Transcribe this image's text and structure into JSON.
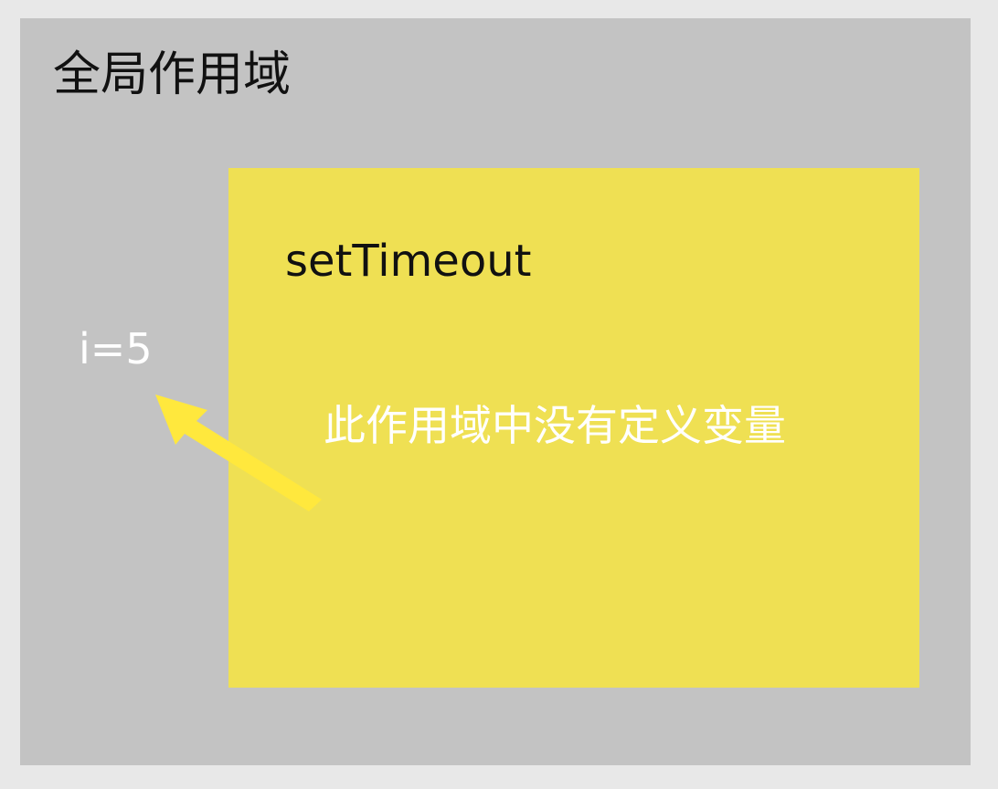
{
  "global_scope": {
    "title": "全局作用域",
    "variable": "i=5"
  },
  "inner_scope": {
    "title": "setTimeout",
    "note": "此作用域中没有定义变量"
  },
  "colors": {
    "page_background": "#e8e8e8",
    "global_scope_background": "#c3c3c3",
    "inner_scope_background": "#efe053",
    "arrow": "#ffe83d",
    "dark_text": "#111111",
    "light_text": "#ffffff"
  }
}
